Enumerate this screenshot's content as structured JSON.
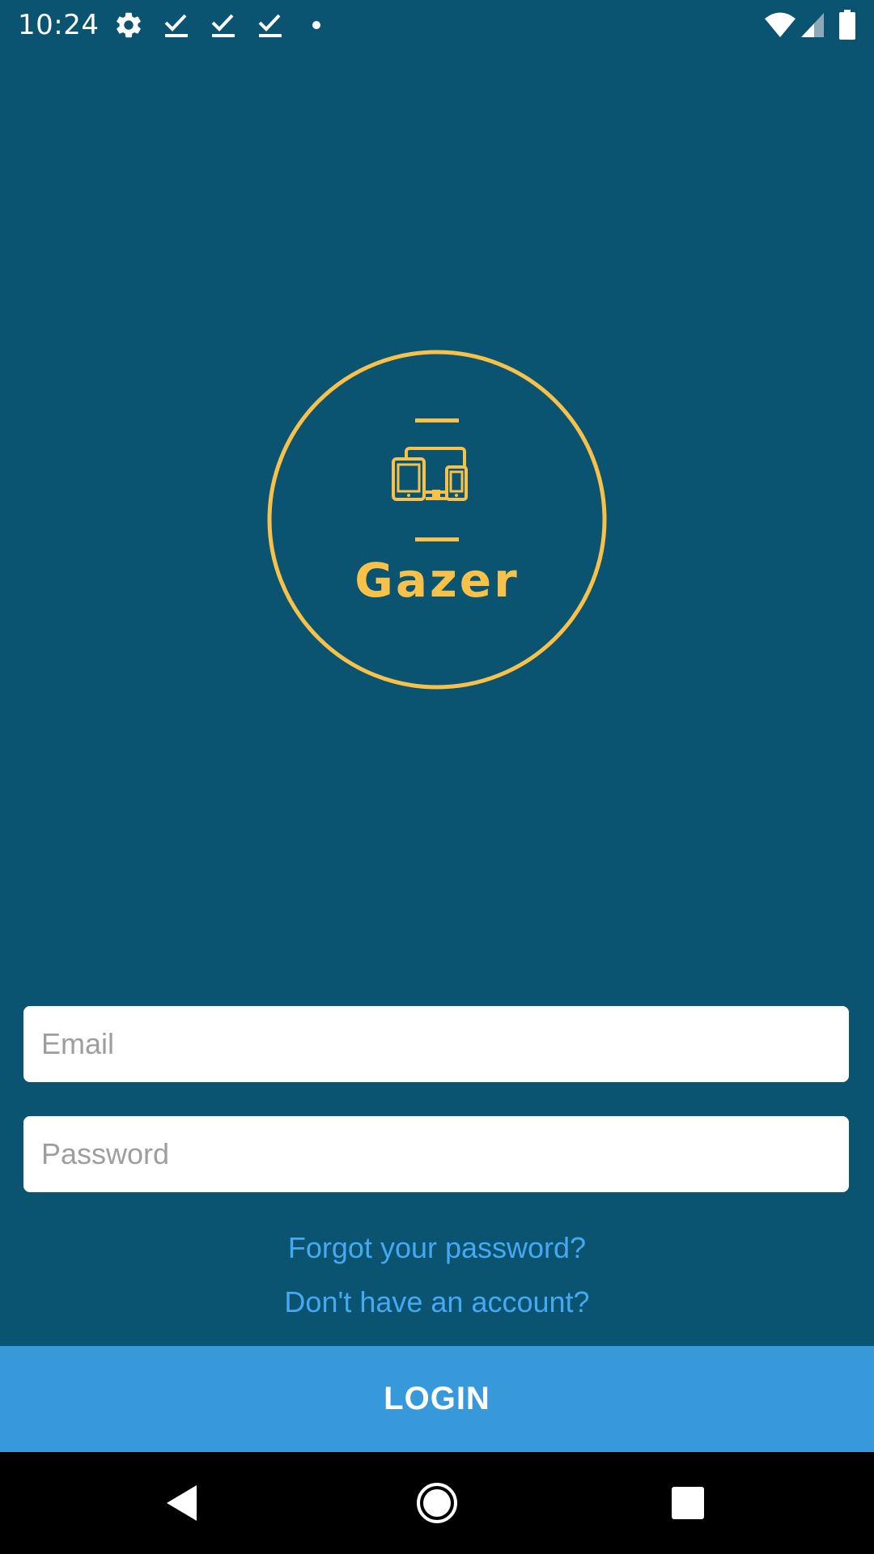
{
  "status_bar": {
    "time": "10:24",
    "icons": [
      "gear-icon",
      "check-icon",
      "check-icon",
      "check-icon",
      "dot-icon",
      "wifi-icon",
      "signal-icon",
      "battery-icon"
    ]
  },
  "logo": {
    "title": "Gazer",
    "icon": "devices-icon",
    "color": "#f8c24a"
  },
  "form": {
    "email_placeholder": "Email",
    "password_placeholder": "Password",
    "forgot_link": "Forgot your password?",
    "signup_link": "Don't have an account?",
    "login_label": "LOGIN"
  },
  "nav": {
    "buttons": [
      "back-icon",
      "home-icon",
      "recents-icon"
    ]
  },
  "colors": {
    "background": "#0a5472",
    "accent": "#f8c24a",
    "link": "#46a8f0",
    "button": "#3799da"
  }
}
